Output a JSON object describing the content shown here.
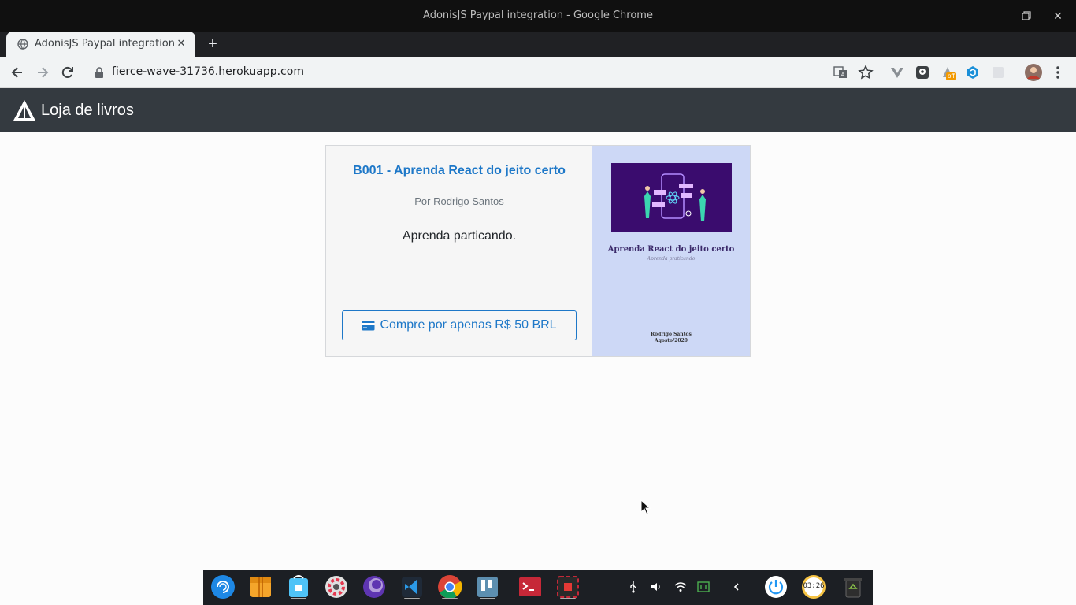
{
  "window": {
    "title": "AdonisJS Paypal integration - Google Chrome"
  },
  "browser": {
    "tab_title": "AdonisJS Paypal integration",
    "url": "fierce-wave-31736.herokuapp.com",
    "extension_badge": "off"
  },
  "navbar": {
    "brand": "Loja de livros"
  },
  "product": {
    "title": "B001 - Aprenda React do jeito certo",
    "author": "Por Rodrigo Santos",
    "description": "Aprenda particando.",
    "buy_label": "Compre por apenas R$ 50 BRL",
    "cover": {
      "title": "Aprenda React do jeito certo",
      "subtitle": "Aprenda praticando",
      "author": "Rodrigo Santos",
      "date": "Agosto/2020"
    }
  },
  "dock": {
    "apps": [
      "deepin-launcher-icon",
      "file-archiver-icon",
      "app-store-icon",
      "settings-icon",
      "browser-icon",
      "vscode-icon",
      "chrome-icon",
      "terminal-panel-icon",
      "terminal-icon",
      "screen-recorder-icon"
    ],
    "clock": "03:26"
  },
  "colors": {
    "accent": "#1e78c8",
    "navbar": "#343a40",
    "cover_bg": "#cdd8f6"
  }
}
